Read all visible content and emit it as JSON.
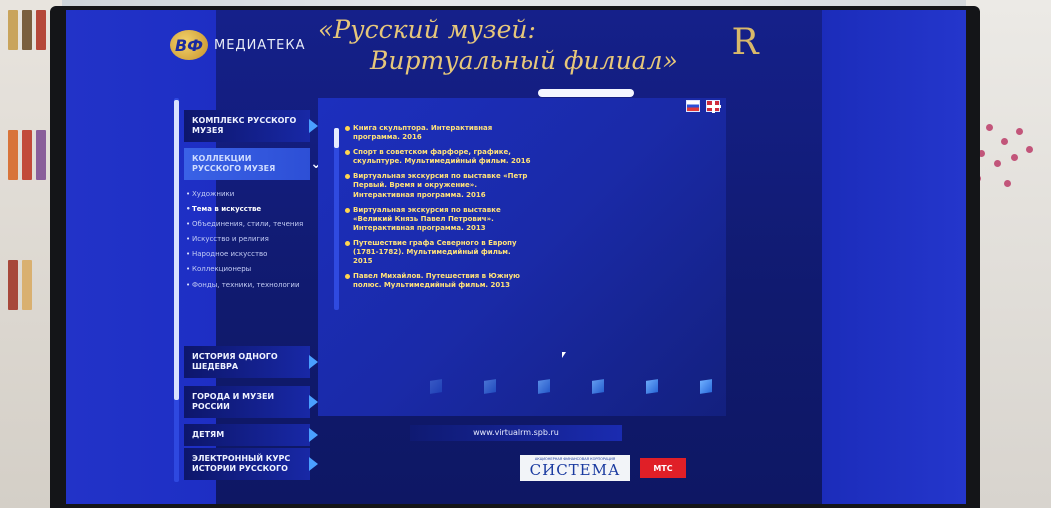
{
  "brand": {
    "logo_mark": "ВФ",
    "logo_text": "МЕДИАТЕКА"
  },
  "title": {
    "line1": "«Русский музей:",
    "line2": "Виртуальный филиал»"
  },
  "crown_monogram": "R",
  "menu": {
    "items": [
      {
        "label": "КОМПЛЕКС РУССКОГО МУЗЕЯ"
      },
      {
        "label": "КОЛЛЕКЦИИ РУССКОГО МУЗЕЯ"
      },
      {
        "label": "ИСТОРИЯ ОДНОГО ШЕДЕВРА"
      },
      {
        "label": "ГОРОДА И МУЗЕИ РОССИИ"
      },
      {
        "label": "ДЕТЯМ"
      },
      {
        "label": "ЭЛЕКТРОННЫЙ КУРС ИСТОРИИ РУССКОГО"
      }
    ],
    "sub_items": [
      "Художники",
      "Тема в искусстве",
      "Объединения, стили, течения",
      "Искусство и религия",
      "Народное искусство",
      "Коллекционеры",
      "Фонды, техники, технологии"
    ]
  },
  "content": {
    "list": [
      "Книга скульптора. Интерактивная программа. 2016",
      "Спорт в советском фарфоре, графике, скульптуре. Мультимедийный фильм. 2016",
      "Виртуальная экскурсия по выставке «Петр Первый. Время и окружение». Интерактивная программа. 2016",
      "Виртуальная экскурсия по выставке «Великий Князь Павел Петрович». Интерактивная программа. 2013",
      "Путешествие графа Северного в Европу (1781-1782). Мультимедийный фильм. 2015",
      "Павел Михайлов. Путешествия в Южную полюс. Мультимедийный фильм. 2013"
    ]
  },
  "url": "www.virtualrm.spb.ru",
  "sponsors": {
    "sistema_small": "АКЦИОНЕРНАЯ ФИНАНСОВАЯ КОРПОРАЦИЯ",
    "sistema": "СИСТЕМА",
    "mts": "МТС"
  },
  "colors": {
    "screen_blue": "#1d2ec4",
    "gold": "#e6c77a",
    "list_yellow": "#ffe27a",
    "mts_red": "#e01f27"
  }
}
